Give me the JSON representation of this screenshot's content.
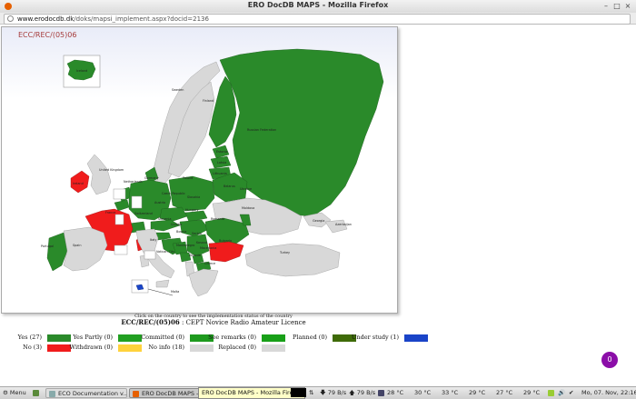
{
  "window": {
    "title": "ERO DocDB MAPS - Mozilla Firefox",
    "url_domain": "www.erodocdb.dk",
    "url_path": "/doks/mapsi_implement.aspx?docid=2136",
    "minimize": "–",
    "maximize": "□",
    "close": "×"
  },
  "map": {
    "title": "ECC/REC/(05)06",
    "click_note": "Click on the country to see the implementation status of the country",
    "doc_ref": "ECC/REC/(05)06",
    "doc_desc": " : CEPT Novice Radio Amateur Licence",
    "labels": {
      "iceland": "Iceland",
      "sweden": "Sweden",
      "finland": "Finland",
      "russia": "Russian Federation",
      "united_kingdom": "United Kingdom",
      "ireland": "Ireland",
      "netherlands": "Netherlands",
      "germany": "Germany",
      "poland": "Poland",
      "belarus": "Belarus",
      "lithuania": "Lithuania",
      "latvia": "Latvia",
      "estonia": "Estonia",
      "ukraine": "Ukraine",
      "czech": "Czech Republic",
      "slovakia": "Slovakia",
      "austria": "Austria",
      "hungary": "Hungary",
      "france": "France",
      "switzerland": "Switzerland",
      "romania": "Romania",
      "moldova": "Moldova",
      "georgia": "Georgia",
      "azerbaijan": "Azerbaijan",
      "portugal": "Portugal",
      "spain": "Spain",
      "italy": "Italy",
      "serbia": "Serbia",
      "bulgaria": "Bulgaria",
      "turkey": "Turkey",
      "greece": "Greece",
      "albania": "Albania",
      "vatican": "Vatican City",
      "montenegro": "Montenegro",
      "kosovo": "Kosovo",
      "macedonia": "Macedonia",
      "slovenia": "Slovenia",
      "croatia": "Croatia",
      "bosnia": "Bosnia",
      "malta": "Malta"
    }
  },
  "legend": [
    {
      "label": "Yes (27)",
      "color": "#2a8a2a"
    },
    {
      "label": "Yes Partly (0)",
      "color": "#22a022"
    },
    {
      "label": "Committed (0)",
      "color": "#1e9a1e"
    },
    {
      "label": "See remarks (0)",
      "color": "#18a018"
    },
    {
      "label": "Planned (0)",
      "color": "#3f6b08"
    },
    {
      "label": "Under study (1)",
      "color": "#1a44c8"
    },
    {
      "label": "No (3)",
      "color": "#f01c1c"
    },
    {
      "label": "Withdrawn (0)",
      "color": "#ffd23c"
    },
    {
      "label": "No info (18)",
      "color": "#d8d8d8"
    },
    {
      "label": "Replaced (0)",
      "color": "#d8d8d8"
    }
  ],
  "badge": "0",
  "taskbar": {
    "menu": "Menu",
    "task1": "ECO Documentation v...",
    "task2": "ERO DocDB MAPS - M...",
    "tooltip": "ERO DocDB MAPS - Mozilla Firefox",
    "net_down": "79 B/s",
    "net_up": "79 B/s",
    "temps": [
      "28 °C",
      "30 °C",
      "33 °C",
      "29 °C",
      "27 °C",
      "29 °C"
    ],
    "clock": "Mo, 07. Nov, 22:16"
  }
}
